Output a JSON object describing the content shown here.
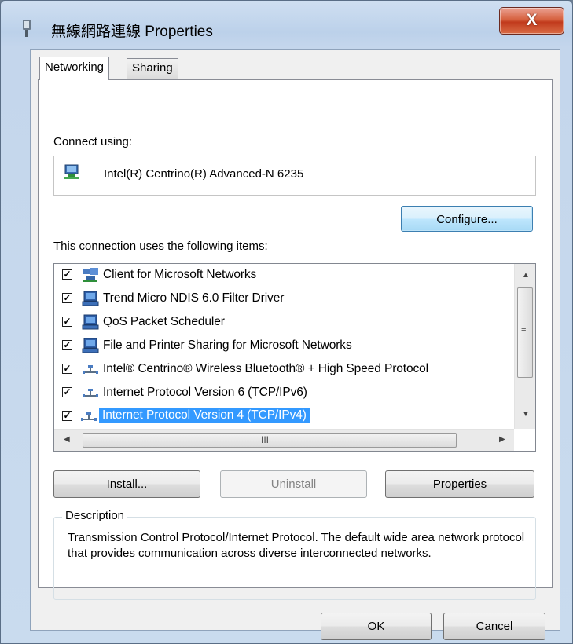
{
  "window": {
    "title": "無線網路連線 Properties",
    "close_label": "X"
  },
  "tabs": [
    {
      "label": "Networking",
      "active": true
    },
    {
      "label": "Sharing",
      "active": false
    }
  ],
  "connect_using": {
    "label": "Connect using:",
    "adapter": "Intel(R) Centrino(R) Advanced-N 6235",
    "adapter_icon": "network-adapter-icon"
  },
  "configure_label": "Configure...",
  "items_label": "This connection uses the following items:",
  "items": [
    {
      "label": "Client for Microsoft Networks",
      "checked": true,
      "icon": "network-client-icon"
    },
    {
      "label": "Trend Micro NDIS 6.0 Filter Driver",
      "checked": true,
      "icon": "service-computer-icon"
    },
    {
      "label": "QoS Packet Scheduler",
      "checked": true,
      "icon": "service-computer-icon"
    },
    {
      "label": "File and Printer Sharing for Microsoft Networks",
      "checked": true,
      "icon": "service-computer-icon"
    },
    {
      "label": "Intel® Centrino® Wireless Bluetooth® + High Speed Protocol",
      "checked": true,
      "icon": "protocol-icon"
    },
    {
      "label": "Internet Protocol Version 6 (TCP/IPv6)",
      "checked": true,
      "icon": "protocol-icon"
    },
    {
      "label": "Internet Protocol Version 4 (TCP/IPv4)",
      "checked": true,
      "icon": "protocol-icon",
      "selected": true
    }
  ],
  "scrollbar": {
    "grip": "III"
  },
  "actions": {
    "install": "Install...",
    "uninstall": "Uninstall",
    "properties": "Properties"
  },
  "description": {
    "legend": "Description",
    "text": "Transmission Control Protocol/Internet Protocol. The default wide area network protocol that provides communication across diverse interconnected networks."
  },
  "footer": {
    "ok": "OK",
    "cancel": "Cancel"
  },
  "colors": {
    "selection": "#3399ff",
    "close": "#c13a1c",
    "titlebar": "#bcd1ea"
  }
}
